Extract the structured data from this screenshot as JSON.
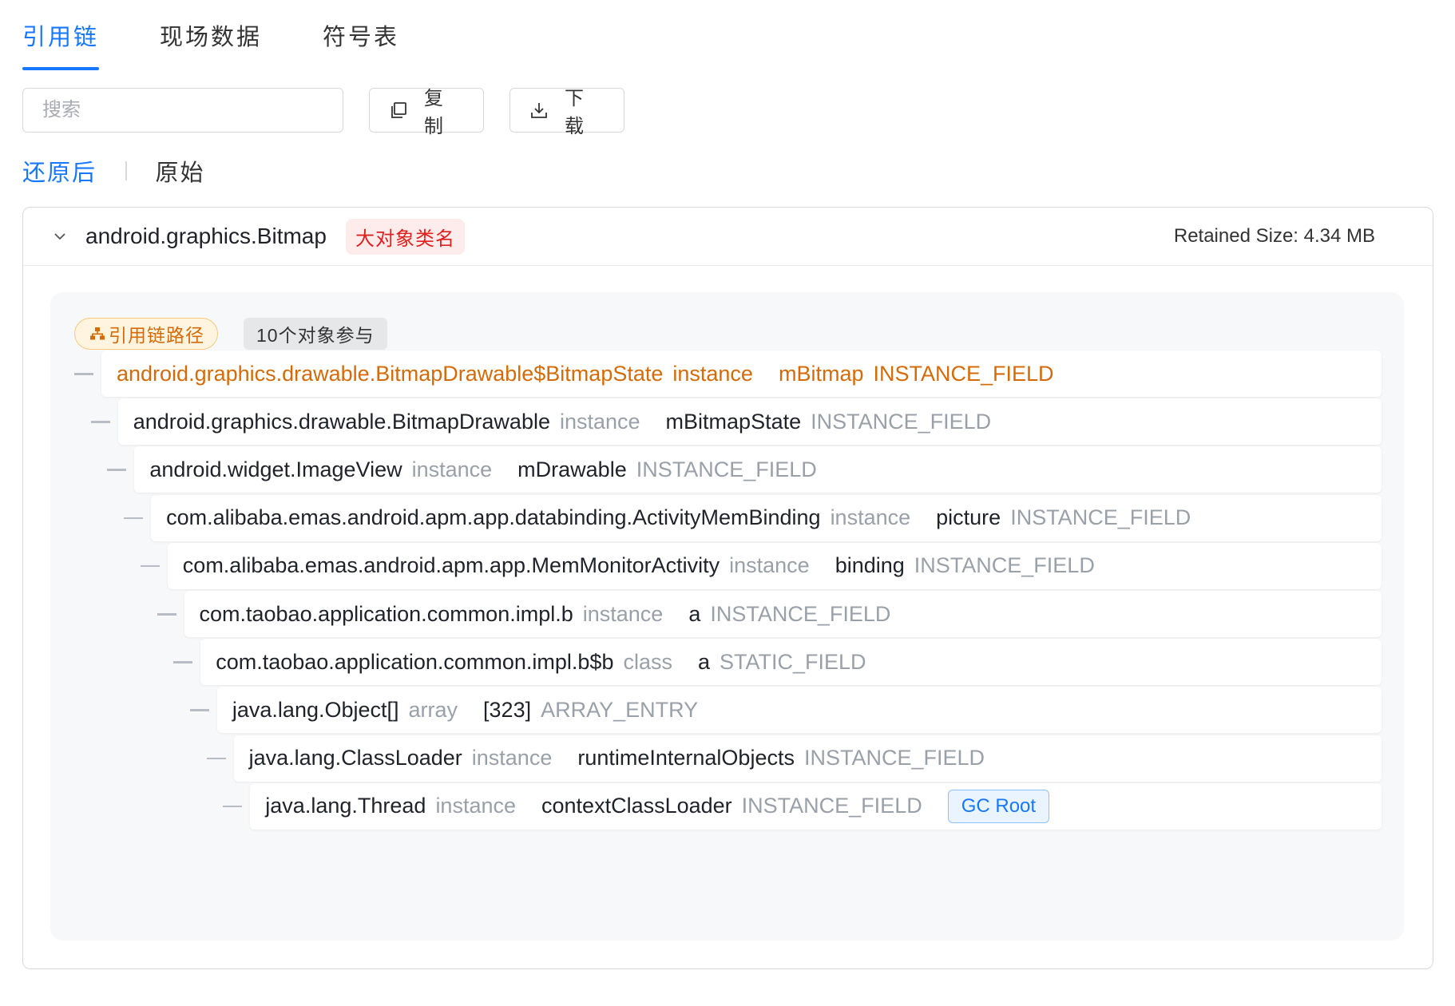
{
  "tabs": [
    {
      "label": "引用链",
      "active": true
    },
    {
      "label": "现场数据",
      "active": false
    },
    {
      "label": "符号表",
      "active": false
    }
  ],
  "toolbar": {
    "search_placeholder": "搜索",
    "copy_label": "复制",
    "download_label": "下载"
  },
  "view_toggle": {
    "restored_label": "还原后",
    "original_label": "原始",
    "active": "restored"
  },
  "card": {
    "object_class": "android.graphics.Bitmap",
    "tag": "大对象类名",
    "retained": "Retained Size: 4.34 MB",
    "path_label": "引用链路径",
    "participants": "10个对象参与"
  },
  "chain": [
    {
      "cls": "android.graphics.drawable.BitmapDrawable$BitmapState",
      "kind": "instance",
      "field": "mBitmap",
      "ftype": "INSTANCE_FIELD"
    },
    {
      "cls": "android.graphics.drawable.BitmapDrawable",
      "kind": "instance",
      "field": "mBitmapState",
      "ftype": "INSTANCE_FIELD"
    },
    {
      "cls": "android.widget.ImageView",
      "kind": "instance",
      "field": "mDrawable",
      "ftype": "INSTANCE_FIELD"
    },
    {
      "cls": "com.alibaba.emas.android.apm.app.databinding.ActivityMemBinding",
      "kind": "instance",
      "field": "picture",
      "ftype": "INSTANCE_FIELD"
    },
    {
      "cls": "com.alibaba.emas.android.apm.app.MemMonitorActivity",
      "kind": "instance",
      "field": "binding",
      "ftype": "INSTANCE_FIELD"
    },
    {
      "cls": "com.taobao.application.common.impl.b",
      "kind": "instance",
      "field": "a",
      "ftype": "INSTANCE_FIELD"
    },
    {
      "cls": "com.taobao.application.common.impl.b$b",
      "kind": "class",
      "field": "a",
      "ftype": "STATIC_FIELD"
    },
    {
      "cls": "java.lang.Object[]",
      "kind": "array",
      "field": "[323]",
      "ftype": "ARRAY_ENTRY"
    },
    {
      "cls": "java.lang.ClassLoader",
      "kind": "instance",
      "field": "runtimeInternalObjects",
      "ftype": "INSTANCE_FIELD"
    },
    {
      "cls": "java.lang.Thread",
      "kind": "instance",
      "field": "contextClassLoader",
      "ftype": "INSTANCE_FIELD",
      "badge": "GC Root"
    }
  ],
  "colors": {
    "accent": "#1677ff",
    "highlight_row": "#d46b08",
    "tag_red": "#e0201e"
  }
}
